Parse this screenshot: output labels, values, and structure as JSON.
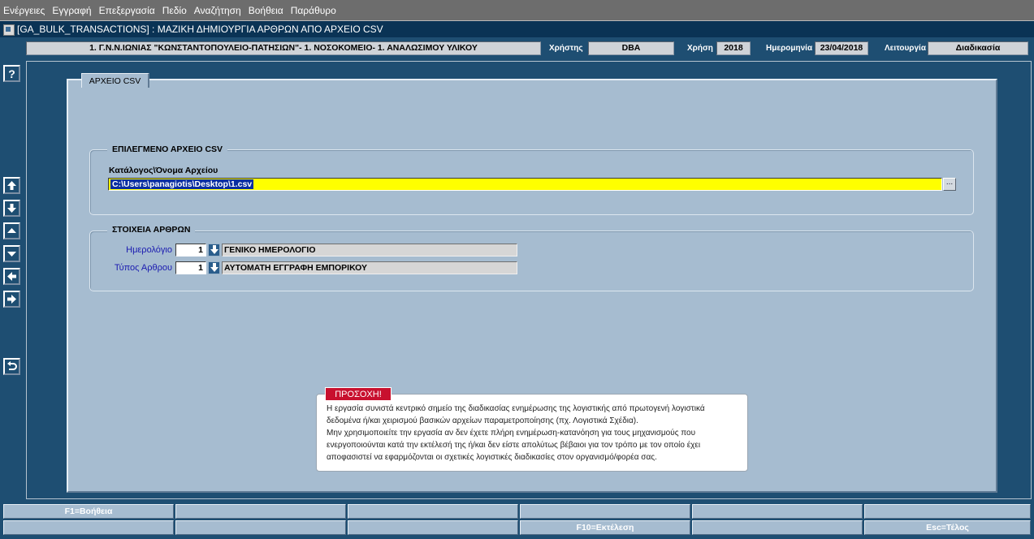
{
  "menu": [
    "Ενέργειες",
    "Εγγραφή",
    "Επεξεργασία",
    "Πεδίο",
    "Αναζήτηση",
    "Βοήθεια",
    "Παράθυρο"
  ],
  "window": {
    "title": "[GA_BULK_TRANSACTIONS]  :  ΜΑΖΙΚΗ ΔΗΜΙΟΥΡΓΙΑ ΑΡΘΡΩΝ ΑΠΟ ΑΡΧΕΙΟ CSV"
  },
  "header": {
    "organization": "1. Γ.Ν.Ν.ΙΩΝΙΑΣ \"ΚΩΝΣΤΑΝΤΟΠΟΥΛΕΙΟ-ΠΑΤΗΣΙΩΝ\"- 1. ΝΟΣΟΚΟΜΕΙΟ- 1. ΑΝΑΛΩΣΙΜΟΥ ΥΛΙΚΟΥ",
    "user_label": "Χρήστης",
    "user_value": "DBA",
    "year_label": "Χρήση",
    "year_value": "2018",
    "date_label": "Ημερομηνία",
    "date_value": "23/04/2018",
    "function_label": "Λειτουργία",
    "function_value": "Διαδικασία"
  },
  "toolbar": {
    "help": "?"
  },
  "tab": {
    "label": "ΑΡΧΕΙΟ CSV"
  },
  "file_group": {
    "legend": "ΕΠΙΛΕΓΜΕΝΟ ΑΡΧΕΙΟ CSV",
    "path_label": "Κατάλογος\\Όνομα Αρχείου",
    "path_value": "C:\\Users\\panagiotis\\Desktop\\1.csv",
    "browse_label": "..."
  },
  "entries_group": {
    "legend": "ΣΤΟΙΧΕΙΑ ΑΡΘΡΩΝ",
    "journal_label": "Ημερολόγιο",
    "journal_code": "1",
    "journal_name": "ΓΕΝΙΚΟ ΗΜΕΡΟΛΟΓΙΟ",
    "entry_type_label": "Τύπος Αρθρου",
    "entry_type_code": "1",
    "entry_type_name": "ΑΥΤΟΜΑΤΗ ΕΓΓΡΑΦΗ ΕΜΠΟΡΙΚΟΥ"
  },
  "warning": {
    "title": "ΠΡΟΣΟΧΗ!",
    "lines": [
      "Η εργασία συνιστά κεντρικό σημείο της διαδικασίας ενημέρωσης της λογιστικής από πρωτογενή λογιστικά",
      "δεδομένα ή/και χειρισμού βασικών αρχείων παραμετροποίησης (πχ. Λογιστικά Σχέδια).",
      "Μην χρησιμοποιείτε την εργασία αν δεν έχετε πλήρη ενημέρωση-κατανόηση για τους μηχανισμούς που",
      "ενεργοποιούνται κατά την εκτέλεσή της ή/και δεν είστε απολύτως βέβαιοι για τον τρόπο με τον οποίο έχει",
      "αποφασιστεί να εφαρμόζονται οι σχετικές λογιστικές διαδικασίες στον οργανισμό/φορέα σας."
    ]
  },
  "fkeys": {
    "f1": "F1=Βοήθεια",
    "f10": "F10=Εκτέλεση",
    "esc": "Esc=Τέλος"
  },
  "colors": {
    "background": "#1e4e72",
    "panel": "#a6bcd0",
    "path_highlight": "#ffff00",
    "warning_title": "#c8102e",
    "label_blue": "#1a1ab0"
  }
}
